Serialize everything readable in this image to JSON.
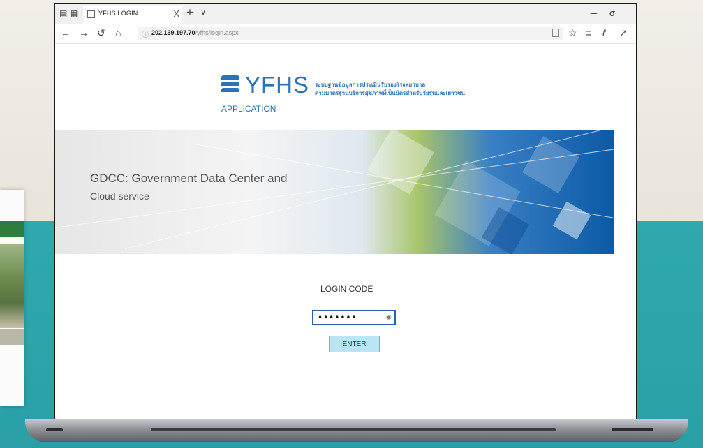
{
  "browser": {
    "tab_title": "YFHS LOGIN",
    "tab_close": "X",
    "new_tab": "+",
    "tab_menu": "∨",
    "min": "–",
    "max": "σ",
    "address_host": "202.139.197.70",
    "address_path": "/yfhs/login.aspx"
  },
  "page": {
    "logo_text": "YFHS",
    "logo_sub": "APPLICATION",
    "thai_line1": "ระบบฐานข้อมูลการประเมินรับรองโรงพยาบาล",
    "thai_line2": "ตามมาตรฐานบริการสุขภาพที่เป็นมิตรสำหรับวัยรุ่นและเยาวชน",
    "banner_line1": "GDCC: Government Data Center and",
    "banner_line2": "Cloud service",
    "login_label": "LOGIN CODE",
    "password_value": "•••••••",
    "enter_label": "ENTER"
  },
  "colors": {
    "brand_blue": "#2b72b6",
    "input_border": "#2b5fb0",
    "enter_button": "#b9e6f5",
    "teal_background": "#2ea9ae"
  },
  "icons": [
    "tab-actions-icon",
    "tab-preview-icon",
    "page-icon",
    "back-icon",
    "forward-icon",
    "refresh-icon",
    "home-icon",
    "info-icon",
    "reading-view-icon",
    "favorite-star-icon",
    "favorites-list-icon",
    "pen-icon",
    "share-icon",
    "eye-icon"
  ]
}
